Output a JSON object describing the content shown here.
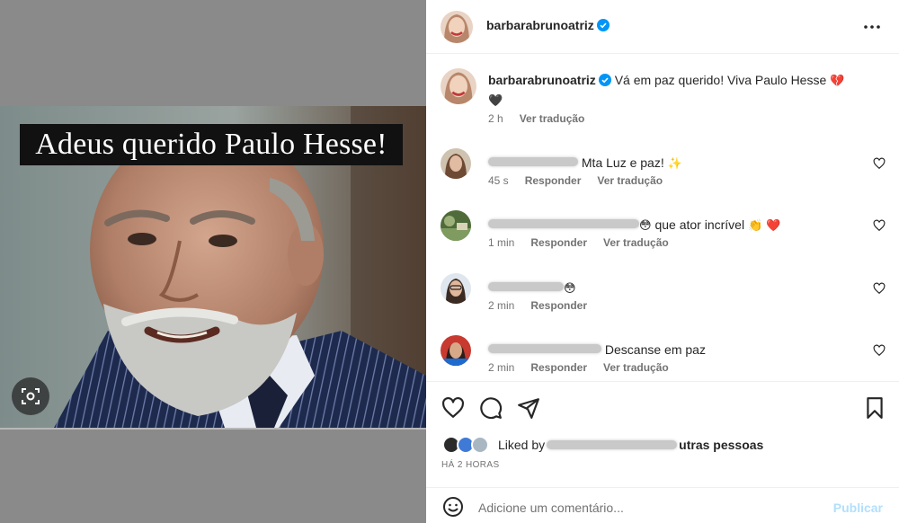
{
  "media": {
    "caption": "Adeus querido Paulo Hesse!",
    "lens_icon": "visual-search-icon"
  },
  "header": {
    "username": "barbarabrunoatriz",
    "verified_icon": "verified-badge-icon",
    "more_icon": "more-horizontal-icon"
  },
  "caption_comment": {
    "username": "barbarabrunoatriz",
    "text": "Vá em paz querido! Viva Paulo Hesse",
    "emoji_1": "💔",
    "emoji_2": "🖤",
    "time": "2 h",
    "translate": "Ver tradução"
  },
  "comments": [
    {
      "text": "Mta Luz e paz!",
      "emoji": "✨",
      "time": "45 s",
      "reply": "Responder",
      "translate": "Ver tradução"
    },
    {
      "text": "que ator incrível",
      "emoji_before": "😳",
      "emoji": "👏 ❤️",
      "time": "1 min",
      "reply": "Responder",
      "translate": "Ver tradução"
    },
    {
      "text": "",
      "emoji": "😳",
      "time": "2 min",
      "reply": "Responder"
    },
    {
      "text": "Descanse em paz",
      "time": "2 min",
      "reply": "Responder",
      "translate": "Ver tradução"
    }
  ],
  "actions": {
    "like_icon": "heart-icon",
    "comment_icon": "comment-icon",
    "share_icon": "send-icon",
    "save_icon": "bookmark-icon"
  },
  "likes": {
    "prefix": "Liked by",
    "suffix": "utras pessoas"
  },
  "timestamp": "Há 2 horas",
  "add_comment": {
    "placeholder": "Adicione um comentário...",
    "post_label": "Publicar",
    "emoji_icon": "smiley-icon"
  },
  "colors": {
    "verified": "#0095f6",
    "heart": "#e0245e",
    "post_disabled": "#b2dffc",
    "meta_text": "#737373"
  }
}
